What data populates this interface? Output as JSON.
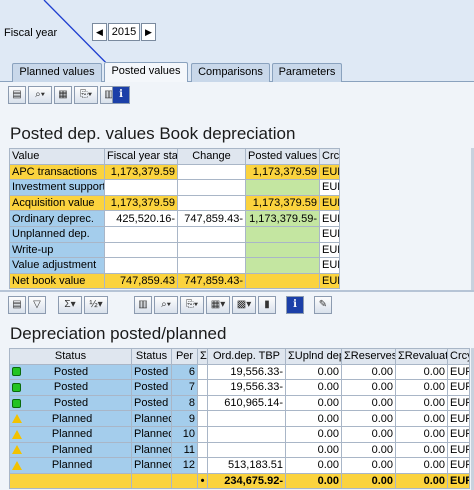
{
  "fiscal_year": {
    "label": "Fiscal year",
    "value": "2015",
    "prev": "◀",
    "next": "▶"
  },
  "tabs": [
    {
      "label": "Planned values",
      "active": false
    },
    {
      "label": "Posted values",
      "active": true
    },
    {
      "label": "Comparisons",
      "active": false
    },
    {
      "label": "Parameters",
      "active": false
    }
  ],
  "posted": {
    "title": "Posted dep. values Book depreciation",
    "columns": [
      "Value",
      "Fiscal year start",
      "Change",
      "Posted values",
      "Crcy"
    ],
    "rows": [
      {
        "label": "APC transactions",
        "start": "1,173,379.59",
        "change": "",
        "posted": "1,173,379.59",
        "crcy": "EUR"
      },
      {
        "label": "Investment support",
        "start": "",
        "change": "",
        "posted": "",
        "crcy": "EUR"
      },
      {
        "label": "Acquisition value",
        "start": "1,173,379.59",
        "change": "",
        "posted": "1,173,379.59",
        "crcy": "EUR"
      },
      {
        "label": "Ordinary deprec.",
        "start": "425,520.16-",
        "change": "747,859.43-",
        "posted": "1,173,379.59-",
        "crcy": "EUR"
      },
      {
        "label": "Unplanned dep.",
        "start": "",
        "change": "",
        "posted": "",
        "crcy": "EUR"
      },
      {
        "label": "Write-up",
        "start": "",
        "change": "",
        "posted": "",
        "crcy": "EUR"
      },
      {
        "label": "Value adjustment",
        "start": "",
        "change": "",
        "posted": "",
        "crcy": "EUR"
      },
      {
        "label": "Net book value",
        "start": "747,859.43",
        "change": "747,859.43-",
        "posted": "",
        "crcy": "EUR"
      }
    ]
  },
  "planned": {
    "title": "Depreciation posted/planned",
    "columns": [
      "Status",
      "Status",
      "Per",
      "Σ",
      "Ord.dep. TBP",
      "ΣUplnd dep.",
      "ΣReserves",
      "ΣRevaluat.",
      "Crcy"
    ],
    "rows": [
      {
        "icon": "green",
        "status1": "Posted",
        "status2": "Posted",
        "per": "6",
        "ord": "19,556.33-",
        "upl": "0.00",
        "res": "0.00",
        "rev": "0.00",
        "crcy": "EUR"
      },
      {
        "icon": "green",
        "status1": "Posted",
        "status2": "Posted",
        "per": "7",
        "ord": "19,556.33-",
        "upl": "0.00",
        "res": "0.00",
        "rev": "0.00",
        "crcy": "EUR"
      },
      {
        "icon": "green",
        "status1": "Posted",
        "status2": "Posted",
        "per": "8",
        "ord": "610,965.14-",
        "upl": "0.00",
        "res": "0.00",
        "rev": "0.00",
        "crcy": "EUR"
      },
      {
        "icon": "yellow",
        "status1": "Planned",
        "status2": "Planned",
        "per": "9",
        "ord": "",
        "upl": "0.00",
        "res": "0.00",
        "rev": "0.00",
        "crcy": "EUR"
      },
      {
        "icon": "yellow",
        "status1": "Planned",
        "status2": "Planned",
        "per": "10",
        "ord": "",
        "upl": "0.00",
        "res": "0.00",
        "rev": "0.00",
        "crcy": "EUR"
      },
      {
        "icon": "yellow",
        "status1": "Planned",
        "status2": "Planned",
        "per": "11",
        "ord": "",
        "upl": "0.00",
        "res": "0.00",
        "rev": "0.00",
        "crcy": "EUR"
      },
      {
        "icon": "yellow",
        "status1": "Planned",
        "status2": "Planned",
        "per": "12",
        "ord": "513,183.51",
        "upl": "0.00",
        "res": "0.00",
        "rev": "0.00",
        "crcy": "EUR"
      }
    ],
    "total": {
      "sigma": "•",
      "ord": "234,675.92-",
      "upl": "0.00",
      "res": "0.00",
      "rev": "0.00",
      "crcy": "EUR"
    }
  },
  "colors": {
    "yellow": "#fbd33e",
    "blue": "#a4cdec",
    "green": "#c4e6a1",
    "frame": "#dfe9f5"
  },
  "icons": {
    "toolbar1": [
      "details-icon",
      "find-icon",
      "sort-icon",
      "export-icon",
      "print-icon",
      "info-icon"
    ],
    "toolbar2": [
      "details-icon",
      "filter-icon",
      "sum-icon",
      "subtotal-icon",
      "print-icon",
      "view-icon",
      "export-icon",
      "layout-icon",
      "grid-icon",
      "chart-icon",
      "info-icon",
      "change-icon"
    ]
  }
}
